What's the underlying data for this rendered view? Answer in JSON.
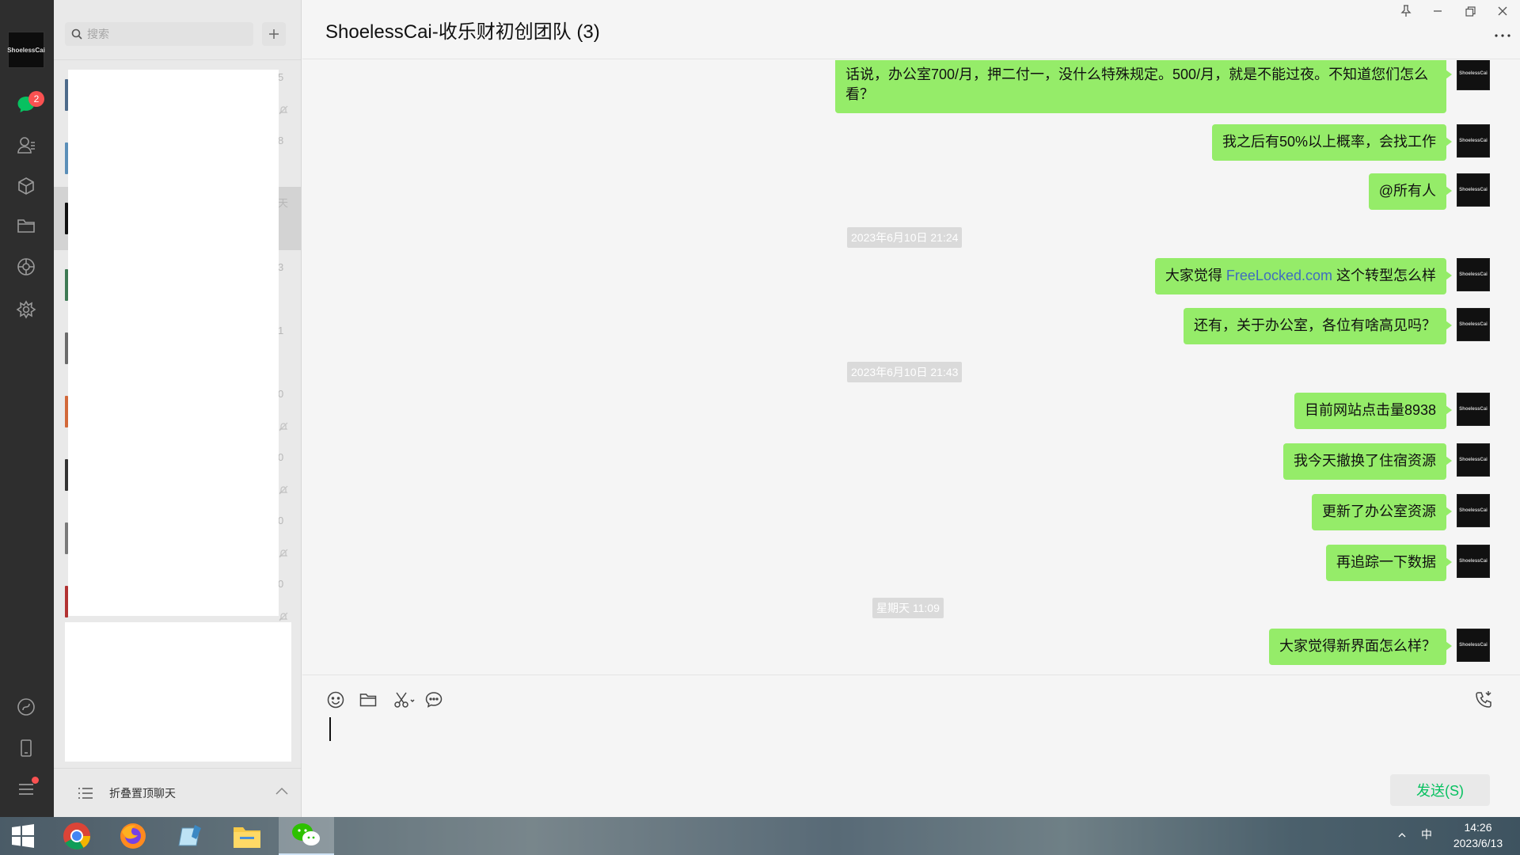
{
  "nav": {
    "avatar_text": "ShoelessCai",
    "chat_badge": "2"
  },
  "list": {
    "search_placeholder": "搜索",
    "rows": [
      {
        "tail": "5"
      },
      {
        "tail": "8"
      },
      {
        "tail": "天"
      },
      {
        "tail": "3"
      },
      {
        "tail": "1"
      },
      {
        "tail": "0"
      },
      {
        "tail": "0"
      },
      {
        "tail": "0"
      },
      {
        "tail": "0"
      }
    ],
    "fold_label": "折叠置顶聊天"
  },
  "chat": {
    "title": "ShoelessCai-收乐财初创团队 (3)",
    "avatar_text": "ShoelessCai",
    "messages": [
      {
        "text": "话说，办公室700/月，押二付一，没什么特殊规定。500/月，就是不能过夜。不知道您们怎么看？"
      },
      {
        "text": "我之后有50%以上概率，会找工作"
      },
      {
        "text": "@所有人"
      },
      {
        "timestamp": "2023年6月10日 21:24"
      },
      {
        "text_before": "大家觉得 ",
        "link": "FreeLocked.com",
        "text_after": " 这个转型怎么样"
      },
      {
        "text": "还有，关于办公室，各位有啥高见吗？"
      },
      {
        "timestamp": "2023年6月10日 21:43"
      },
      {
        "text": "目前网站点击量8938"
      },
      {
        "text": "我今天撤换了住宿资源"
      },
      {
        "text": "更新了办公室资源"
      },
      {
        "text": "再追踪一下数据"
      },
      {
        "timestamp": "星期天 11:09"
      },
      {
        "text": "大家觉得新界面怎么样？"
      }
    ],
    "send_label": "发送(S)"
  },
  "taskbar": {
    "ime": "中",
    "time": "14:26",
    "date": "2023/6/13"
  },
  "colors": {
    "bubble": "#95ec69",
    "link": "#3f6dbf",
    "send_text": "#07c160",
    "badge": "#fa5151"
  }
}
